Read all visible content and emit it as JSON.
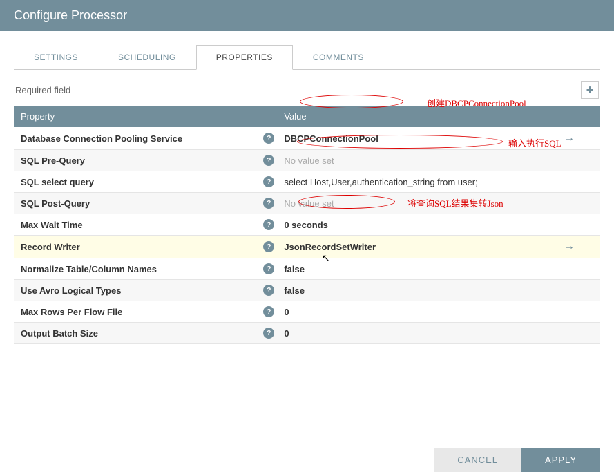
{
  "header": {
    "title": "Configure Processor"
  },
  "tabs": {
    "items": [
      "SETTINGS",
      "SCHEDULING",
      "PROPERTIES",
      "COMMENTS"
    ],
    "active_index": 2
  },
  "req_label": "Required field",
  "table_headers": {
    "property": "Property",
    "value": "Value"
  },
  "properties": [
    {
      "name": "Database Connection Pooling Service",
      "value": "DBCPConnectionPool",
      "bold": true,
      "goto": true,
      "highlight": false
    },
    {
      "name": "SQL Pre-Query",
      "value": "No value set",
      "novalue": true
    },
    {
      "name": "SQL select query",
      "value": "select Host,User,authentication_string from user;"
    },
    {
      "name": "SQL Post-Query",
      "value": "No value set",
      "novalue": true
    },
    {
      "name": "Max Wait Time",
      "value": "0 seconds",
      "bold": true
    },
    {
      "name": "Record Writer",
      "value": "JsonRecordSetWriter",
      "bold": true,
      "goto": true,
      "highlight": true
    },
    {
      "name": "Normalize Table/Column Names",
      "value": "false",
      "bold": true
    },
    {
      "name": "Use Avro Logical Types",
      "value": "false",
      "bold": true
    },
    {
      "name": "Max Rows Per Flow File",
      "value": "0",
      "bold": true
    },
    {
      "name": "Output Batch Size",
      "value": "0",
      "bold": true
    }
  ],
  "annotations": {
    "a1": "创建DBCPConnectionPool",
    "a2": "输入执行SQL",
    "a3": "将查询SQL结果集转Json"
  },
  "buttons": {
    "cancel": "CANCEL",
    "apply": "APPLY"
  },
  "add_symbol": "+",
  "help_symbol": "?",
  "goto_symbol": "→"
}
